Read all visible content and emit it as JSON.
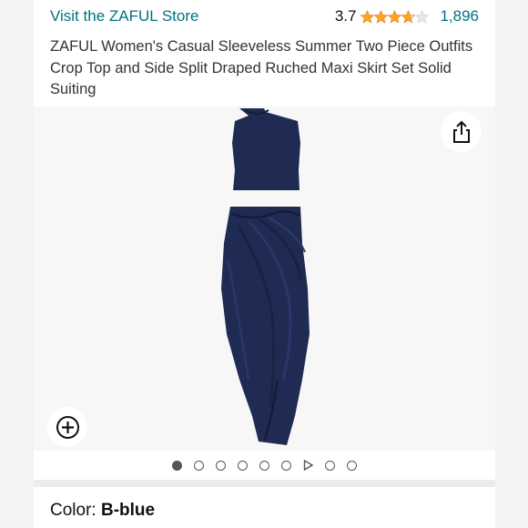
{
  "store": {
    "link_text": "Visit the ZAFUL Store"
  },
  "rating": {
    "value": "3.7",
    "stars_filled": 3.7,
    "stars_total": 5,
    "review_count": "1,896",
    "star_color": "#ffa41c"
  },
  "product": {
    "title": "ZAFUL Women's Casual Sleeveless Summer Two Piece Outfits Crop Top and Side Split Draped Ruched Maxi Skirt Set Solid Suiting",
    "garment_color": "#1f2b52"
  },
  "gallery": {
    "share_icon": "share-icon",
    "zoom_icon": "zoom-plus-icon",
    "dots": [
      "active",
      "dot",
      "dot",
      "dot",
      "dot",
      "dot",
      "video",
      "dot",
      "dot"
    ]
  },
  "color": {
    "label": "Color: ",
    "value": "B-blue"
  },
  "accents": {
    "link": "#007185",
    "text": "#0f1111"
  }
}
